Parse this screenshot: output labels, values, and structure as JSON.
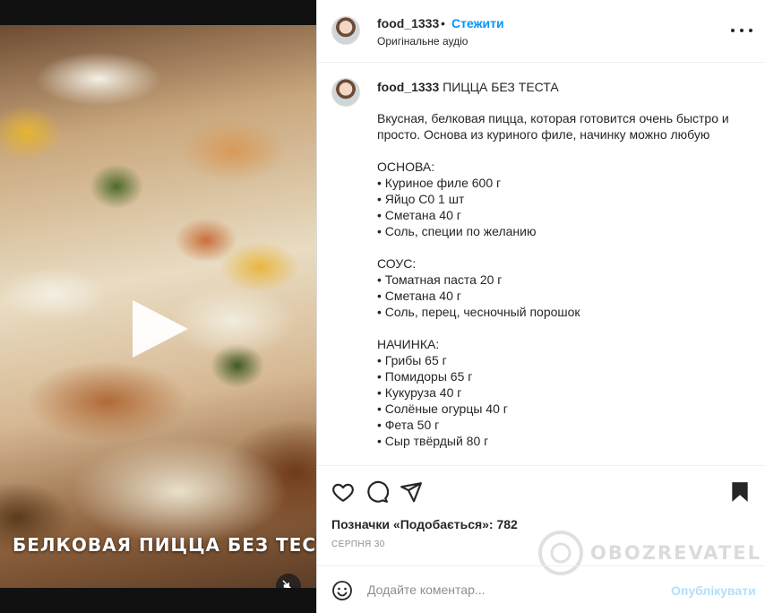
{
  "post": {
    "media": {
      "overlay_text": "БЕЛКОВАЯ ПИЦЦА БЕЗ ТЕСТА"
    },
    "header": {
      "username": "food_1333",
      "separator": "•",
      "follow_label": "Стежити",
      "audio_label": "Оригінальне аудіо"
    },
    "caption": {
      "username": "food_1333",
      "title": "ПИЦЦА БЕЗ ТЕСТА",
      "lines": [
        "Вкусная, белковая пицца, которая готовится очень быстро и просто. Основа из куриного филе, начинку можно любую",
        "",
        "ОСНОВА:",
        "• Куриное филе 600 г",
        "• Яйцо С0 1 шт",
        "• Сметана 40 г",
        "• Соль, специи по желанию",
        "",
        "СОУС:",
        "• Томатная паста 20 г",
        "• Сметана 40 г",
        "• Соль, перец, чесночный порошок",
        "",
        "НАЧИНКА:",
        "• Грибы 65 г",
        "• Помидоры 65 г",
        "• Кукуруза 40 г",
        "• Солёные огурцы 40 г",
        "• Фета 50 г",
        "• Сыр твёрдый 80 г"
      ]
    },
    "actions": {
      "icons": [
        "heart-icon",
        "comment-icon",
        "share-icon",
        "bookmark-icon"
      ],
      "likes_text": "Позначки «Подобається»: 782",
      "date": "СЕРПНЯ 30"
    },
    "watermark": "OBOZREVATEL",
    "comment": {
      "placeholder": "Додайте коментар...",
      "publish_label": "Опублікувати"
    }
  },
  "colors": {
    "accent": "#0095f6",
    "publish_disabled": "#b2dffc",
    "text": "#262626",
    "muted": "#8e8e8e"
  }
}
